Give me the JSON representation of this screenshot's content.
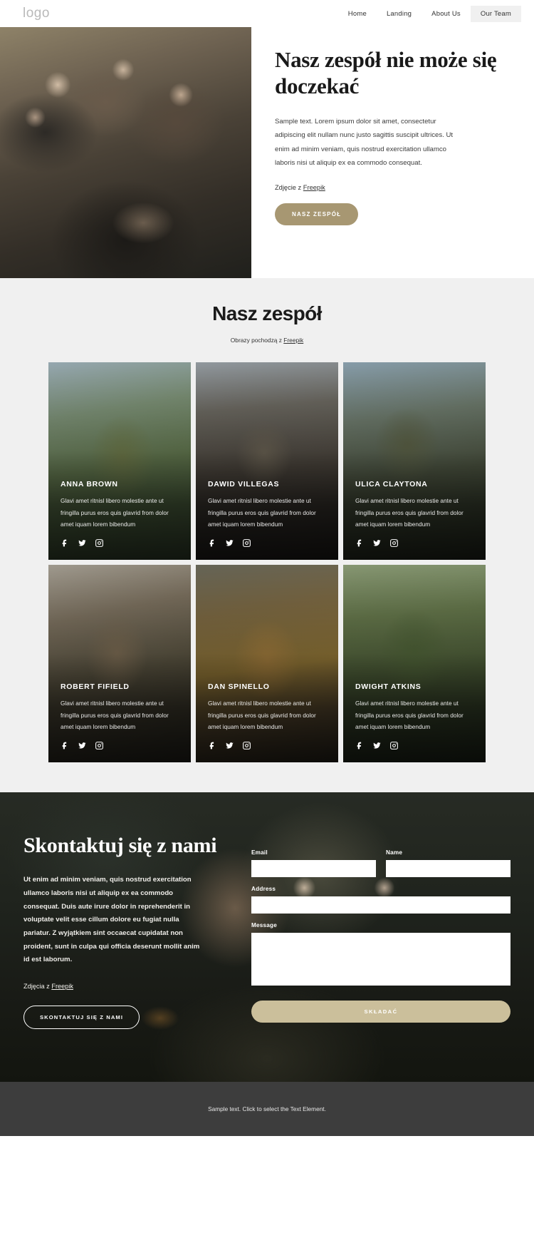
{
  "header": {
    "logo": "logo",
    "nav": [
      {
        "label": "Home",
        "active": false
      },
      {
        "label": "Landing",
        "active": false
      },
      {
        "label": "About Us",
        "active": false
      },
      {
        "label": "Our Team",
        "active": true
      }
    ]
  },
  "hero": {
    "title": "Nasz zespół nie może się doczekać",
    "paragraph": "Sample text. Lorem ipsum dolor sit amet, consectetur adipiscing elit nullam nunc justo sagittis suscipit ultrices. Ut enim ad minim veniam, quis nostrud exercitation ullamco laboris nisi ut aliquip ex ea commodo consequat.",
    "credit_prefix": "Zdjęcie z ",
    "credit_link": "Freepik",
    "button": "NASZ ZESPÓŁ",
    "image_alt": "team-hero-photo"
  },
  "team": {
    "title": "Nasz zespół",
    "subtitle_prefix": "Obrazy pochodzą z ",
    "subtitle_link": "Freepik",
    "members": [
      {
        "name": "ANNA BROWN",
        "desc": "Glavi amet ritnisl libero molestie ante ut fringilla purus eros quis glavrid from dolor amet iquam lorem bibendum",
        "photo_class": "p1"
      },
      {
        "name": "DAWID VILLEGAS",
        "desc": "Glavi amet ritnisl libero molestie ante ut fringilla purus eros quis glavrid from dolor amet iquam lorem bibendum",
        "photo_class": "p2"
      },
      {
        "name": "ULICA CLAYTONA",
        "desc": "Glavi amet ritnisl libero molestie ante ut fringilla purus eros quis glavrid from dolor amet iquam lorem bibendum",
        "photo_class": "p3"
      },
      {
        "name": "ROBERT FIFIELD",
        "desc": "Glavi amet ritnisl libero molestie ante ut fringilla purus eros quis glavrid from dolor amet iquam lorem bibendum",
        "photo_class": "p4"
      },
      {
        "name": "DAN SPINELLO",
        "desc": "Glavi amet ritnisl libero molestie ante ut fringilla purus eros quis glavrid from dolor amet iquam lorem bibendum",
        "photo_class": "p5"
      },
      {
        "name": "DWIGHT ATKINS",
        "desc": "Glavi amet ritnisl libero molestie ante ut fringilla purus eros quis glavrid from dolor amet iquam lorem bibendum",
        "photo_class": "p6"
      }
    ],
    "social_icons": [
      "facebook-icon",
      "twitter-icon",
      "instagram-icon"
    ]
  },
  "contact": {
    "title": "Skontaktuj się z nami",
    "paragraph": "Ut enim ad minim veniam, quis nostrud exercitation ullamco laboris nisi ut aliquip ex ea commodo consequat. Duis aute irure dolor in reprehenderit in voluptate velit esse cillum dolore eu fugiat nulla pariatur. Z wyjątkiem sint occaecat cupidatat non proident, sunt in culpa qui officia deserunt mollit anim id est laborum.",
    "credit_prefix": "Zdjęcia z ",
    "credit_link": "Freepik",
    "button": "SKONTAKTUJ SIĘ Z NAMI",
    "form": {
      "email_label": "Email",
      "email_value": "",
      "email_placeholder": "",
      "name_label": "Name",
      "name_value": "",
      "name_placeholder": "",
      "address_label": "Address",
      "address_value": "",
      "address_placeholder": "",
      "message_label": "Message",
      "message_value": "",
      "message_placeholder": "",
      "submit_label": "SKŁADAĆ"
    }
  },
  "footer": {
    "text": "Sample text. Click to select the Text Element."
  },
  "colors": {
    "accent_button": "#a79772",
    "submit_button": "#cbbf9b",
    "team_bg": "#f0f0f0",
    "footer_bg": "#3d3d3d"
  }
}
